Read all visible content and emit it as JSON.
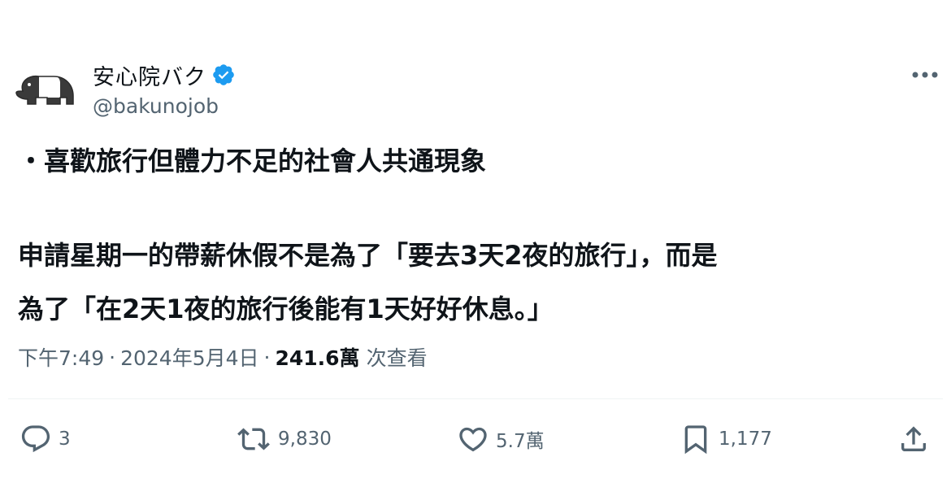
{
  "author": {
    "display_name": "安心院バク",
    "handle": "@bakunojob",
    "verified": true,
    "verified_color": "#1d9bf0",
    "avatar_icon": "tapir-icon"
  },
  "more_icon": "more-horizontal-icon",
  "tweet": {
    "lines": [
      "・喜歡旅行但體力不足的社會人共通現象",
      "申請星期一的帶薪休假不是為了「要去3天2夜的旅行」，而是",
      "為了「在2天1夜的旅行後能有1天好好休息。」"
    ]
  },
  "meta": {
    "time": "下午7:49",
    "separator": "·",
    "date": "2024年5月4日",
    "views_count": "241.6萬",
    "views_label": "次查看"
  },
  "actions": {
    "reply": {
      "icon": "reply-icon",
      "count": "3"
    },
    "retweet": {
      "icon": "retweet-icon",
      "count": "9,830"
    },
    "like": {
      "icon": "heart-icon",
      "count": "5.7萬"
    },
    "bookmark": {
      "icon": "bookmark-icon",
      "count": "1,177"
    },
    "share": {
      "icon": "share-icon"
    }
  },
  "colors": {
    "text": "#0f1419",
    "secondary": "#536471",
    "divider": "#eff3f4"
  }
}
